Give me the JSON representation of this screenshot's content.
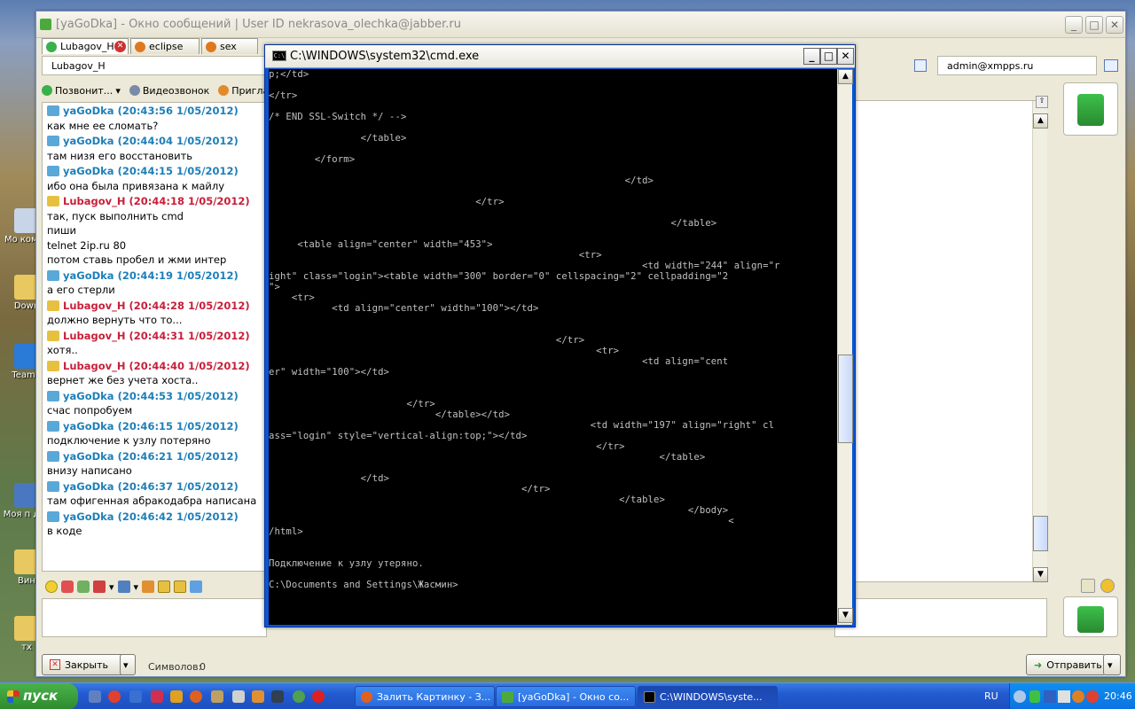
{
  "chat_window": {
    "title": "[yaGoDka] - Окно сообщений | User ID nekrasova_olechka@jabber.ru",
    "tabs": [
      {
        "label": "Lubagov_H",
        "active": true
      },
      {
        "label": "eclipse",
        "active": false
      },
      {
        "label": "sex",
        "active": false
      }
    ],
    "contact": "Lubagov_H",
    "account": "admin@xmpps.ru",
    "toolbar": {
      "call": "Позвонит...",
      "video": "Видеозвонок",
      "invite": "Пригла"
    },
    "messages": [
      {
        "author": "yaGoDka",
        "time": "(20:43:56 1/05/2012)",
        "dir": "in",
        "lines": [
          "как мне ее сломать?"
        ]
      },
      {
        "author": "yaGoDka",
        "time": "(20:44:04 1/05/2012)",
        "dir": "in",
        "lines": [
          "там низя его восстановить"
        ]
      },
      {
        "author": "yaGoDka",
        "time": "(20:44:15 1/05/2012)",
        "dir": "in",
        "lines": [
          "ибо она была привязана к майлу"
        ]
      },
      {
        "author": "Lubagov_H",
        "time": "(20:44:18 1/05/2012)",
        "dir": "out",
        "lines": [
          "так, пуск выполнить cmd",
          "пиши",
          "telnet 2ip.ru 80",
          "потом ставь пробел и жми интер"
        ]
      },
      {
        "author": "yaGoDka",
        "time": "(20:44:19 1/05/2012)",
        "dir": "in",
        "lines": [
          "а его стерли"
        ]
      },
      {
        "author": "Lubagov_H",
        "time": "(20:44:28 1/05/2012)",
        "dir": "out",
        "lines": [
          "должно вернуть что то..."
        ]
      },
      {
        "author": "Lubagov_H",
        "time": "(20:44:31 1/05/2012)",
        "dir": "out",
        "lines": [
          "хотя.."
        ]
      },
      {
        "author": "Lubagov_H",
        "time": "(20:44:40 1/05/2012)",
        "dir": "out",
        "lines": [
          "вернет же без учета хоста.."
        ]
      },
      {
        "author": "yaGoDka",
        "time": "(20:44:53 1/05/2012)",
        "dir": "in",
        "lines": [
          "счас попробуем"
        ]
      },
      {
        "author": "yaGoDka",
        "time": "(20:46:15 1/05/2012)",
        "dir": "in",
        "lines": [
          "подключение к узлу потеряно"
        ]
      },
      {
        "author": "yaGoDka",
        "time": "(20:46:21 1/05/2012)",
        "dir": "in",
        "lines": [
          "внизу написано"
        ]
      },
      {
        "author": "yaGoDka",
        "time": "(20:46:37 1/05/2012)",
        "dir": "in",
        "lines": [
          "там офигенная абракодабра написана"
        ]
      },
      {
        "author": "yaGoDka",
        "time": "(20:46:42 1/05/2012)",
        "dir": "in",
        "lines": [
          "в коде"
        ]
      }
    ],
    "bottom": {
      "close": "Закрыть",
      "chars_label": "Символов:",
      "chars_value": "0",
      "send": "Отправить"
    }
  },
  "cmd_window": {
    "title": "C:\\WINDOWS\\system32\\cmd.exe",
    "lines": [
      "p;</td>",
      "",
      "</tr>",
      "",
      "/* END SSL-Switch */ -->",
      "",
      "                </table>",
      "",
      "        </form>",
      "",
      "                                                              </td>",
      "",
      "                                    </tr>",
      "",
      "                                                                      </table>",
      "",
      "     <table align=\"center\" width=\"453\">",
      "                                                      <tr>",
      "                                                                 <td width=\"244\" align=\"r",
      "ight\" class=\"login\"><table width=\"300\" border=\"0\" cellspacing=\"2\" cellpadding=\"2",
      "\">",
      "    <tr>",
      "           <td align=\"center\" width=\"100\"></td>",
      "",
      "",
      "                                                  </tr>",
      "                                                         <tr>",
      "                                                                 <td align=\"cent",
      "er\" width=\"100\"></td>",
      "",
      "",
      "                        </tr>",
      "                             </table></td>",
      "                                                        <td width=\"197\" align=\"right\" cl",
      "ass=\"login\" style=\"vertical-align:top;\"></td>",
      "                                                         </tr>",
      "                                                                    </table>",
      "",
      "                </td>",
      "                                            </tr>",
      "                                                             </table>",
      "                                                                         </body>",
      "                                                                                <",
      "/html>",
      "",
      "",
      "Подключение к узлу утеряно.",
      "",
      "C:\\Documents and Settings\\Жасмин>"
    ]
  },
  "desktop_icons": [
    "Мо компь",
    "Down",
    "TeamV",
    "Моя п дис",
    "Вин",
    "тх"
  ],
  "taskbar": {
    "start": "пуск",
    "tasks": [
      {
        "label": "Залить Картинку - З...",
        "active": false
      },
      {
        "label": "[yaGoDka] - Окно со...",
        "active": false
      },
      {
        "label": "C:\\WINDOWS\\syste...",
        "active": true
      }
    ],
    "lang": "RU",
    "clock": "20:46"
  }
}
